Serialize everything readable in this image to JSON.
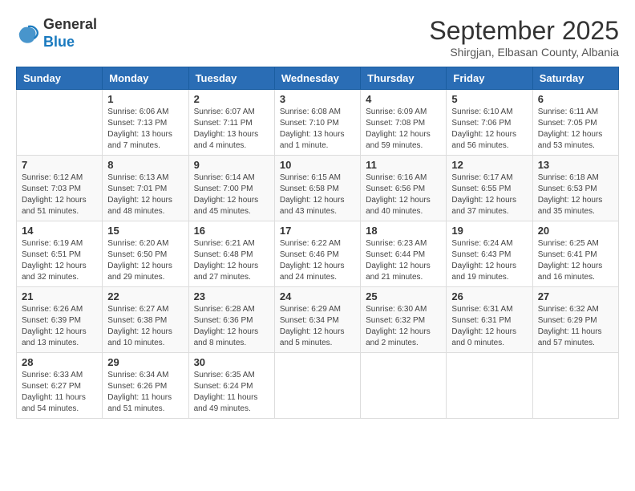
{
  "header": {
    "logo_general": "General",
    "logo_blue": "Blue",
    "month_title": "September 2025",
    "subtitle": "Shirgjan, Elbasan County, Albania"
  },
  "days_of_week": [
    "Sunday",
    "Monday",
    "Tuesday",
    "Wednesday",
    "Thursday",
    "Friday",
    "Saturday"
  ],
  "weeks": [
    [
      {
        "day": "",
        "sunrise": "",
        "sunset": "",
        "daylight": ""
      },
      {
        "day": "1",
        "sunrise": "Sunrise: 6:06 AM",
        "sunset": "Sunset: 7:13 PM",
        "daylight": "Daylight: 13 hours and 7 minutes."
      },
      {
        "day": "2",
        "sunrise": "Sunrise: 6:07 AM",
        "sunset": "Sunset: 7:11 PM",
        "daylight": "Daylight: 13 hours and 4 minutes."
      },
      {
        "day": "3",
        "sunrise": "Sunrise: 6:08 AM",
        "sunset": "Sunset: 7:10 PM",
        "daylight": "Daylight: 13 hours and 1 minute."
      },
      {
        "day": "4",
        "sunrise": "Sunrise: 6:09 AM",
        "sunset": "Sunset: 7:08 PM",
        "daylight": "Daylight: 12 hours and 59 minutes."
      },
      {
        "day": "5",
        "sunrise": "Sunrise: 6:10 AM",
        "sunset": "Sunset: 7:06 PM",
        "daylight": "Daylight: 12 hours and 56 minutes."
      },
      {
        "day": "6",
        "sunrise": "Sunrise: 6:11 AM",
        "sunset": "Sunset: 7:05 PM",
        "daylight": "Daylight: 12 hours and 53 minutes."
      }
    ],
    [
      {
        "day": "7",
        "sunrise": "Sunrise: 6:12 AM",
        "sunset": "Sunset: 7:03 PM",
        "daylight": "Daylight: 12 hours and 51 minutes."
      },
      {
        "day": "8",
        "sunrise": "Sunrise: 6:13 AM",
        "sunset": "Sunset: 7:01 PM",
        "daylight": "Daylight: 12 hours and 48 minutes."
      },
      {
        "day": "9",
        "sunrise": "Sunrise: 6:14 AM",
        "sunset": "Sunset: 7:00 PM",
        "daylight": "Daylight: 12 hours and 45 minutes."
      },
      {
        "day": "10",
        "sunrise": "Sunrise: 6:15 AM",
        "sunset": "Sunset: 6:58 PM",
        "daylight": "Daylight: 12 hours and 43 minutes."
      },
      {
        "day": "11",
        "sunrise": "Sunrise: 6:16 AM",
        "sunset": "Sunset: 6:56 PM",
        "daylight": "Daylight: 12 hours and 40 minutes."
      },
      {
        "day": "12",
        "sunrise": "Sunrise: 6:17 AM",
        "sunset": "Sunset: 6:55 PM",
        "daylight": "Daylight: 12 hours and 37 minutes."
      },
      {
        "day": "13",
        "sunrise": "Sunrise: 6:18 AM",
        "sunset": "Sunset: 6:53 PM",
        "daylight": "Daylight: 12 hours and 35 minutes."
      }
    ],
    [
      {
        "day": "14",
        "sunrise": "Sunrise: 6:19 AM",
        "sunset": "Sunset: 6:51 PM",
        "daylight": "Daylight: 12 hours and 32 minutes."
      },
      {
        "day": "15",
        "sunrise": "Sunrise: 6:20 AM",
        "sunset": "Sunset: 6:50 PM",
        "daylight": "Daylight: 12 hours and 29 minutes."
      },
      {
        "day": "16",
        "sunrise": "Sunrise: 6:21 AM",
        "sunset": "Sunset: 6:48 PM",
        "daylight": "Daylight: 12 hours and 27 minutes."
      },
      {
        "day": "17",
        "sunrise": "Sunrise: 6:22 AM",
        "sunset": "Sunset: 6:46 PM",
        "daylight": "Daylight: 12 hours and 24 minutes."
      },
      {
        "day": "18",
        "sunrise": "Sunrise: 6:23 AM",
        "sunset": "Sunset: 6:44 PM",
        "daylight": "Daylight: 12 hours and 21 minutes."
      },
      {
        "day": "19",
        "sunrise": "Sunrise: 6:24 AM",
        "sunset": "Sunset: 6:43 PM",
        "daylight": "Daylight: 12 hours and 19 minutes."
      },
      {
        "day": "20",
        "sunrise": "Sunrise: 6:25 AM",
        "sunset": "Sunset: 6:41 PM",
        "daylight": "Daylight: 12 hours and 16 minutes."
      }
    ],
    [
      {
        "day": "21",
        "sunrise": "Sunrise: 6:26 AM",
        "sunset": "Sunset: 6:39 PM",
        "daylight": "Daylight: 12 hours and 13 minutes."
      },
      {
        "day": "22",
        "sunrise": "Sunrise: 6:27 AM",
        "sunset": "Sunset: 6:38 PM",
        "daylight": "Daylight: 12 hours and 10 minutes."
      },
      {
        "day": "23",
        "sunrise": "Sunrise: 6:28 AM",
        "sunset": "Sunset: 6:36 PM",
        "daylight": "Daylight: 12 hours and 8 minutes."
      },
      {
        "day": "24",
        "sunrise": "Sunrise: 6:29 AM",
        "sunset": "Sunset: 6:34 PM",
        "daylight": "Daylight: 12 hours and 5 minutes."
      },
      {
        "day": "25",
        "sunrise": "Sunrise: 6:30 AM",
        "sunset": "Sunset: 6:32 PM",
        "daylight": "Daylight: 12 hours and 2 minutes."
      },
      {
        "day": "26",
        "sunrise": "Sunrise: 6:31 AM",
        "sunset": "Sunset: 6:31 PM",
        "daylight": "Daylight: 12 hours and 0 minutes."
      },
      {
        "day": "27",
        "sunrise": "Sunrise: 6:32 AM",
        "sunset": "Sunset: 6:29 PM",
        "daylight": "Daylight: 11 hours and 57 minutes."
      }
    ],
    [
      {
        "day": "28",
        "sunrise": "Sunrise: 6:33 AM",
        "sunset": "Sunset: 6:27 PM",
        "daylight": "Daylight: 11 hours and 54 minutes."
      },
      {
        "day": "29",
        "sunrise": "Sunrise: 6:34 AM",
        "sunset": "Sunset: 6:26 PM",
        "daylight": "Daylight: 11 hours and 51 minutes."
      },
      {
        "day": "30",
        "sunrise": "Sunrise: 6:35 AM",
        "sunset": "Sunset: 6:24 PM",
        "daylight": "Daylight: 11 hours and 49 minutes."
      },
      {
        "day": "",
        "sunrise": "",
        "sunset": "",
        "daylight": ""
      },
      {
        "day": "",
        "sunrise": "",
        "sunset": "",
        "daylight": ""
      },
      {
        "day": "",
        "sunrise": "",
        "sunset": "",
        "daylight": ""
      },
      {
        "day": "",
        "sunrise": "",
        "sunset": "",
        "daylight": ""
      }
    ]
  ]
}
